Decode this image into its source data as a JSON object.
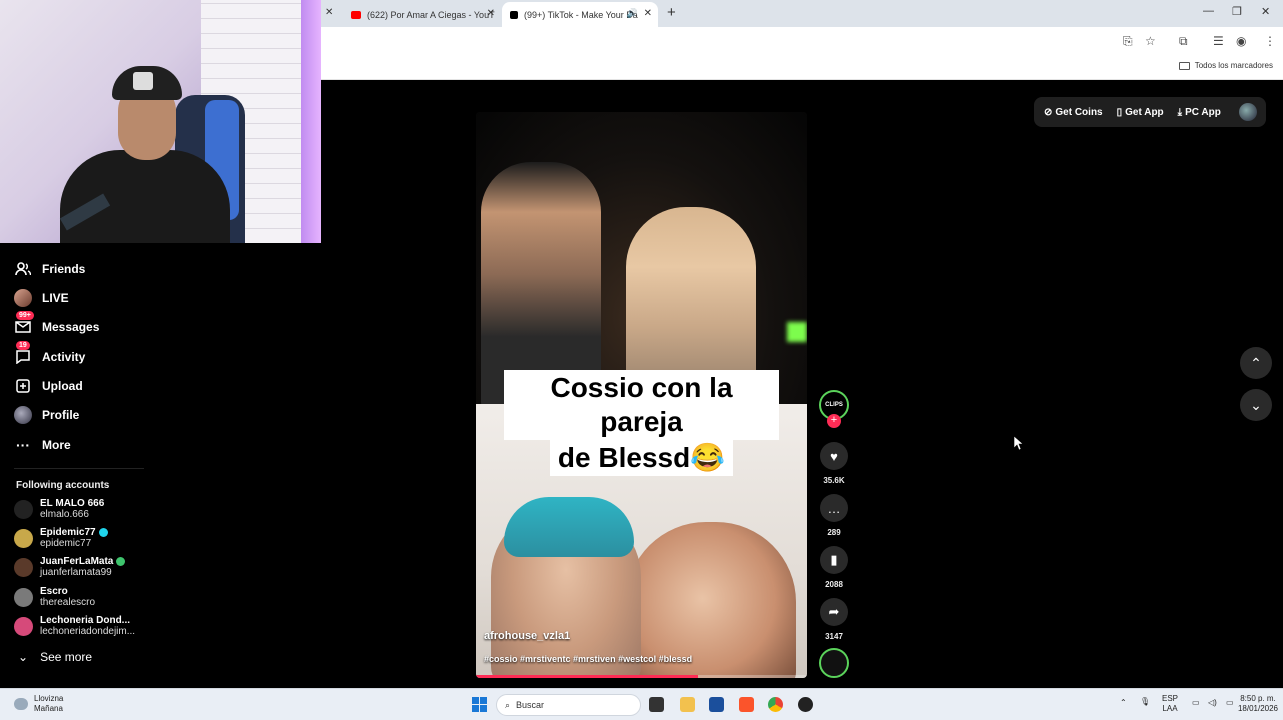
{
  "browser": {
    "tabs": [
      {
        "label": "(622) Por Amar A Ciegas - YouT",
        "favicon_color": "#ff0000"
      },
      {
        "label": "(99+) TikTok - Make Your Da",
        "favicon_color": "#000000"
      }
    ],
    "new_tab": "+",
    "bookmarks_folder": "Todos los marcadores"
  },
  "tiktok": {
    "header_actions": {
      "get_coins": "Get Coins",
      "get_app": "Get App",
      "pc_app": "PC App"
    },
    "sidebar": {
      "nav": [
        {
          "label": "Friends",
          "icon": "friends-icon",
          "badge": ""
        },
        {
          "label": "LIVE",
          "icon": "live-avatar",
          "badge": ""
        },
        {
          "label": "Messages",
          "icon": "messages-icon",
          "badge": "99+"
        },
        {
          "label": "Activity",
          "icon": "activity-icon",
          "badge": "19"
        },
        {
          "label": "Upload",
          "icon": "upload-icon",
          "badge": ""
        },
        {
          "label": "Profile",
          "icon": "profile-avatar",
          "badge": ""
        },
        {
          "label": "More",
          "icon": "more-icon",
          "badge": ""
        }
      ],
      "following_title": "Following accounts",
      "following": [
        {
          "name": "EL MALO 666",
          "handle": "elmalo.666",
          "verified": "",
          "color": "#222222"
        },
        {
          "name": "Epidemic77",
          "handle": "epidemic77",
          "verified": "blue",
          "color": "#c8a84a"
        },
        {
          "name": "JuanFerLaMata",
          "handle": "juanferlamata99",
          "verified": "green",
          "color": "#5a3a2a"
        },
        {
          "name": "Escro",
          "handle": "therealescro",
          "verified": "",
          "color": "#7a7a7a"
        },
        {
          "name": "Lechoneria Dond...",
          "handle": "lechoneriadondejim...",
          "verified": "",
          "color": "#d64a7a"
        }
      ],
      "see_more": "See more"
    },
    "video": {
      "caption_line1": "Cossio con la pareja",
      "caption_line2": "de Blessd😂",
      "username": "afrohouse_vzla1",
      "description": "#cossio #mrstiventc #mrstiven #westcol #blessd",
      "progress": 0.67,
      "creator_avatar_text": "CLIPS"
    },
    "actions": {
      "likes": "35.6K",
      "comments": "289",
      "saves": "2088",
      "shares": "3147"
    }
  },
  "taskbar": {
    "weather_title": "Llovizna",
    "weather_sub": "Mañana",
    "search_placeholder": "Buscar",
    "lang_line1": "ESP",
    "lang_line2": "LAA",
    "time": "8:50 p. m.",
    "date": "18/01/2026"
  }
}
